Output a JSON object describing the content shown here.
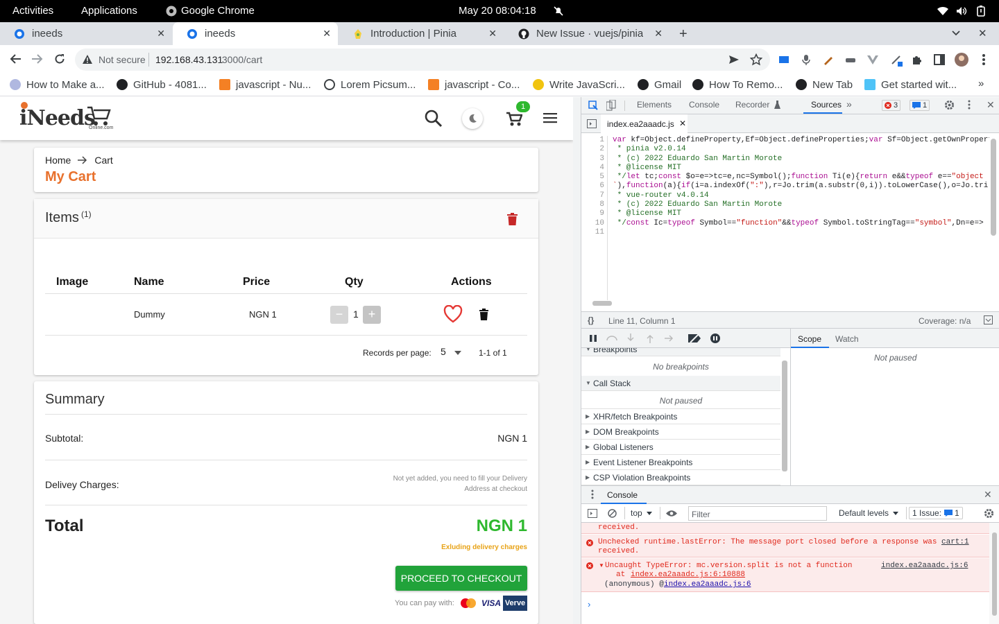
{
  "system_bar": {
    "activities": "Activities",
    "applications": "Applications",
    "app_name": "Google Chrome",
    "clock": "May 20  08:04:18"
  },
  "tabs": [
    {
      "title": "ineeds",
      "active": false
    },
    {
      "title": "ineeds",
      "active": true
    },
    {
      "title": "Introduction | Pinia",
      "active": false
    },
    {
      "title": "New Issue · vuejs/pinia",
      "active": false
    }
  ],
  "address_bar": {
    "security": "Not secure",
    "host": "192.168.43.131",
    "path": ":3000/cart"
  },
  "bookmarks": [
    "How to Make a...",
    "GitHub - 4081...",
    "javascript - Nu...",
    "Lorem Picsum...",
    "javascript - Co...",
    "Write JavaScri...",
    "Gmail",
    "How To Remo...",
    "New Tab",
    "Get started wit..."
  ],
  "app": {
    "logo_text": "iNeeds",
    "logo_sub": "Online.com",
    "cart_badge": "1",
    "breadcrumb": {
      "home": "Home",
      "current": "Cart"
    },
    "page_title": "My Cart",
    "items_heading": "Items",
    "items_count": "(1)",
    "table": {
      "headers": [
        "Image",
        "Name",
        "Price",
        "Qty",
        "Actions"
      ],
      "rows": [
        {
          "name": "Dummy",
          "price": "NGN 1",
          "qty": "1"
        }
      ]
    },
    "pagination": {
      "label": "Records per page:",
      "per_page": "5",
      "range": "1-1 of 1"
    },
    "summary": {
      "heading": "Summary",
      "subtotal_label": "Subtotal:",
      "subtotal_value": "NGN 1",
      "delivery_label": "Delivey Charges:",
      "delivery_note_1": "Not yet added, you need to fill your Delivery",
      "delivery_note_2": "Address at checkout",
      "total_label": "Total",
      "total_value": "NGN 1",
      "excluding_note": "Exluding delivery charges",
      "checkout_button": "PROCEED TO CHECKOUT",
      "pay_with": "You can pay with:",
      "visa": "VISA",
      "verve": "Verve"
    }
  },
  "devtools": {
    "tabs": [
      "Elements",
      "Console",
      "Recorder",
      "Sources"
    ],
    "active_tab": "Sources",
    "error_count": "3",
    "issue_count": "1",
    "file_tab": "index.ea2aaadc.js",
    "line_numbers": [
      "1",
      "2",
      "3",
      "4",
      "5",
      "6",
      "7",
      "8",
      "9",
      "10",
      "11"
    ],
    "status_position": "Line 11, Column 1",
    "coverage": "Coverage: n/a",
    "sections": {
      "breakpoints": "Breakpoints",
      "no_breakpoints": "No breakpoints",
      "call_stack": "Call Stack",
      "not_paused": "Not paused",
      "xhr": "XHR/fetch Breakpoints",
      "dom": "DOM Breakpoints",
      "global": "Global Listeners",
      "event": "Event Listener Breakpoints",
      "csp": "CSP Violation Breakpoints"
    },
    "scope_tab": "Scope",
    "watch_tab": "Watch",
    "scope_status": "Not paused",
    "console": {
      "title": "Console",
      "context": "top",
      "filter_placeholder": "Filter",
      "levels": "Default levels",
      "issues": "1 Issue:",
      "issues_count": "1",
      "msg_prev_tail": "received.",
      "msg1_text": "Unchecked runtime.lastError: The message port closed before a response was",
      "msg1_link": "cart:1",
      "msg1_tail": "received.",
      "msg2_text": "Uncaught TypeError: mc.version.split is not a function",
      "msg2_link": "index.ea2aaadc.js:6",
      "msg2_at": "at ",
      "msg2_at_link": "index.ea2aaadc.js:6:10888",
      "msg2_anon": "(anonymous) @ ",
      "msg2_anon_link": "index.ea2aaadc.js:6"
    }
  }
}
